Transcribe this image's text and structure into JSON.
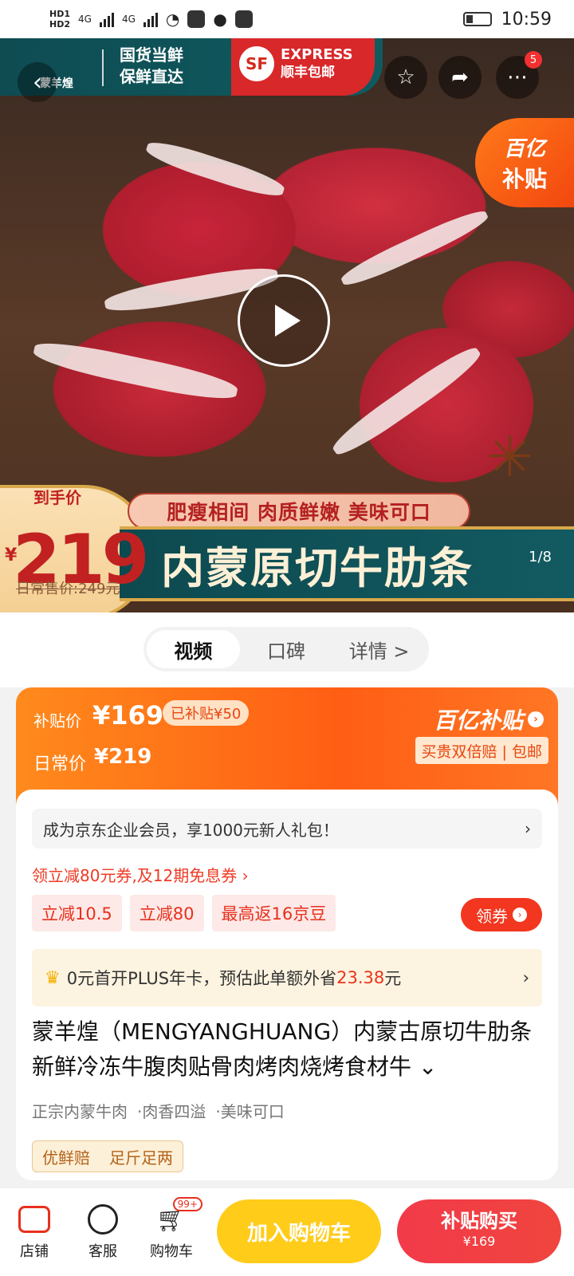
{
  "status_bar": {
    "time": "10:59",
    "network": "4G",
    "hd1": "HD1",
    "hd2": "HD2"
  },
  "hero": {
    "brand_logo": "蒙羊煌",
    "brand_slogan_1": "国货当鲜",
    "brand_slogan_2": "保鲜直达",
    "sf_mark": "SF",
    "sf_en": "EXPRESS",
    "sf_cn": "顺丰包邮",
    "more_badge": "5",
    "yi_corner_1": "百亿",
    "yi_corner_2": "补贴",
    "tagline": "肥瘦相间 肉质鲜嫩 美味可口",
    "title": "内蒙原切牛肋条",
    "price_label": "到手价",
    "price_currency": "¥",
    "price_value": "219",
    "original_price": "日常售价:249元",
    "image_counter": "1/8"
  },
  "tabs": [
    "视频",
    "口碑",
    "详情 >"
  ],
  "subsidy": {
    "sub_price_label": "补贴价",
    "sub_price_value": "¥169",
    "subsidy_pill": "已补贴¥50",
    "daily_label": "日常价",
    "daily_value": "¥219",
    "yi_logo": "百亿补贴",
    "yi_note": "买贵双倍赔 | 包邮"
  },
  "body": {
    "enterprise": "成为京东企业会员，享1000元新人礼包！",
    "coupon_line": "领立减80元券,及12期免息券 ›",
    "coupon_tags": [
      "立减10.5",
      "立减80",
      "最高返16京豆"
    ],
    "get_coupon": "领券",
    "plus_prefix": "0元首开PLUS年卡，预估此单额外省",
    "plus_amount": "23.38",
    "plus_suffix": "元",
    "product_title": "蒙羊煌（MENGYANGHUANG）内蒙古原切牛肋条新鲜冷冻牛腹肉贴骨肉烤肉烧烤食材牛",
    "features": [
      "正宗内蒙牛肉",
      "·肉香四溢",
      "·美味可口"
    ],
    "badges": [
      "优鲜赔",
      "足斤足两"
    ]
  },
  "bottom_bar": {
    "store": "店铺",
    "service": "客服",
    "cart": "购物车",
    "cart_badge": "99+",
    "add_to_cart": "加入购物车",
    "buy_now": "补贴购买",
    "buy_price": "¥169"
  }
}
